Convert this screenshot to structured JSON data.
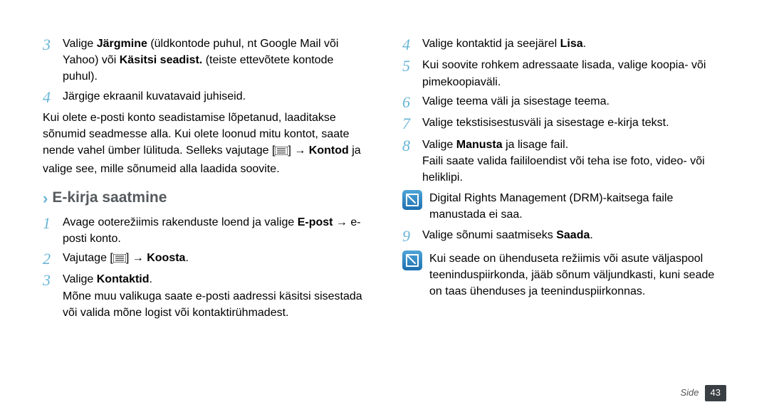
{
  "left": {
    "step3_a": "Valige ",
    "step3_b": "Järgmine",
    "step3_c": " (üldkontode puhul, nt Google Mail või Yahoo) või ",
    "step3_d": "Käsitsi seadist.",
    "step3_e": " (teiste ettevõtete kontode puhul).",
    "step4": "Järgige ekraanil kuvatavaid juhiseid.",
    "para1_a": "Kui olete e-posti konto seadistamise lõpetanud, laaditakse sõnumid seadmesse alla. Kui olete loonud mitu kontot, saate nende vahel ümber lülituda. Selleks vajutage [",
    "para1_arrow": "] → ",
    "para1_b": "Kontod",
    "para1_c": " ja valige see, mille sõnumeid alla laadida soovite.",
    "heading": "E-kirja saatmine",
    "s1_a": "Avage ooterežiimis rakenduste loend ja valige ",
    "s1_b": "E-post",
    "s1_c": " → e-posti konto.",
    "s2_a": "Vajutage [",
    "s2_arrow": "] → ",
    "s2_b": "Koosta",
    "s2_c": ".",
    "s3_a": "Valige ",
    "s3_b": "Kontaktid",
    "s3_c": ".",
    "s3_extra": "Mõne muu valikuga saate e-posti aadressi käsitsi sisestada või valida mõne logist või kontaktirühmadest."
  },
  "right": {
    "s4_a": "Valige kontaktid ja seejärel ",
    "s4_b": "Lisa",
    "s4_c": ".",
    "s5": "Kui soovite rohkem adressaate lisada, valige koopia- või pimekoopiaväli.",
    "s6": "Valige teema väli ja sisestage teema.",
    "s7": "Valige tekstisisestusväli ja sisestage e-kirja tekst.",
    "s8_a": "Valige ",
    "s8_b": "Manusta",
    "s8_c": " ja lisage fail.",
    "s8_extra": "Faili saate valida faililoendist või teha ise foto, video- või heliklipi.",
    "note1": "Digital Rights Management (DRM)-kaitsega faile manustada ei saa.",
    "s9_a": "Valige sõnumi saatmiseks ",
    "s9_b": "Saada",
    "s9_c": ".",
    "note2": "Kui seade on ühenduseta režiimis või asute väljaspool teeninduspiirkonda, jääb sõnum väljundkasti, kuni seade on taas ühenduses ja teeninduspiirkonnas."
  },
  "footer": {
    "label": "Side",
    "page": "43"
  }
}
